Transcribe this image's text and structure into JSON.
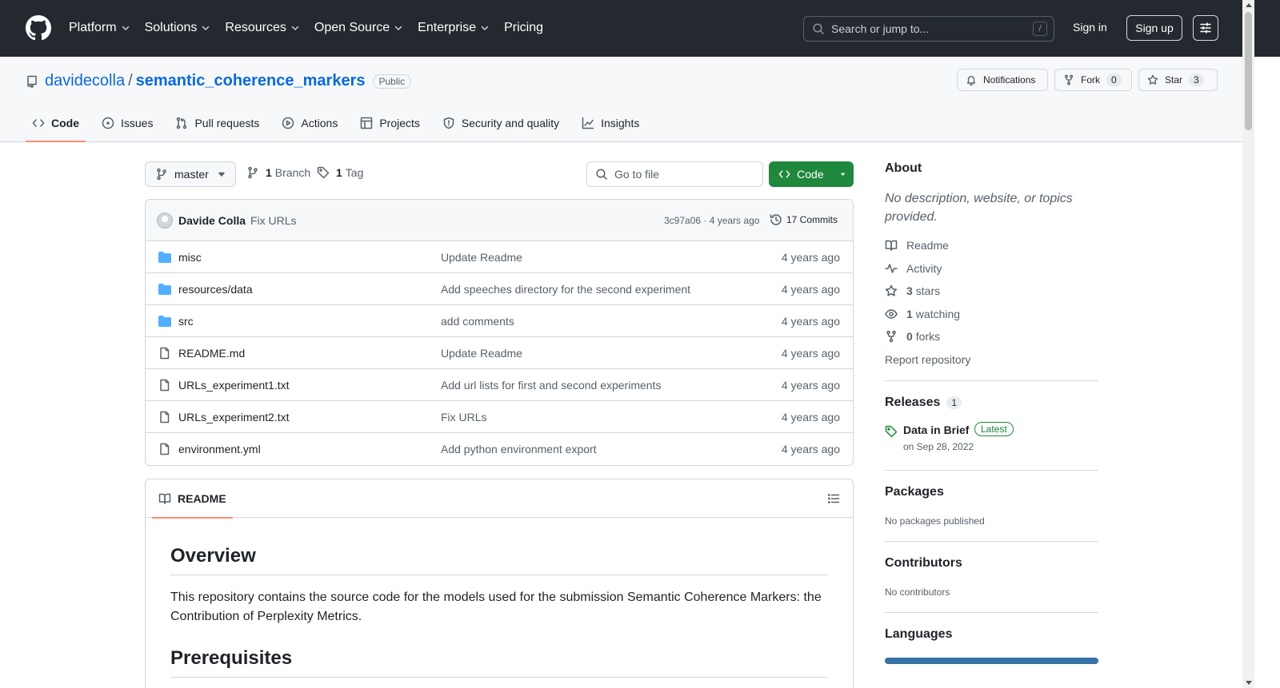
{
  "header": {
    "nav": [
      "Platform",
      "Solutions",
      "Resources",
      "Open Source",
      "Enterprise",
      "Pricing"
    ],
    "search_placeholder": "Search or jump to...",
    "search_shortcut": "/",
    "signin": "Sign in",
    "signup": "Sign up"
  },
  "repo": {
    "owner": "davidecolla",
    "separator": "/",
    "name": "semantic_coherence_markers",
    "visibility": "Public",
    "notifications": "Notifications",
    "fork": "Fork",
    "fork_count": "0",
    "star": "Star",
    "star_count": "3"
  },
  "tabs": [
    "Code",
    "Issues",
    "Pull requests",
    "Actions",
    "Projects",
    "Security and quality",
    "Insights"
  ],
  "toolbar": {
    "branch": "master",
    "branch_count": "1",
    "branch_label": "Branch",
    "tag_count": "1",
    "tag_label": "Tag",
    "go_to_file": "Go to file",
    "code": "Code"
  },
  "commit": {
    "author": "Davide Colla",
    "message": "Fix URLs",
    "hash_age": "3c97a06 · 4 years ago",
    "commits": "17 Commits"
  },
  "files": [
    {
      "type": "folder",
      "name": "misc",
      "message": "Update Readme",
      "age": "4 years ago"
    },
    {
      "type": "folder",
      "name": "resources/data",
      "message": "Add speeches directory for the second experiment",
      "age": "4 years ago"
    },
    {
      "type": "folder",
      "name": "src",
      "message": "add comments",
      "age": "4 years ago"
    },
    {
      "type": "file",
      "name": "README.md",
      "message": "Update Readme",
      "age": "4 years ago"
    },
    {
      "type": "file",
      "name": "URLs_experiment1.txt",
      "message": "Add url lists for first and second experiments",
      "age": "4 years ago"
    },
    {
      "type": "file",
      "name": "URLs_experiment2.txt",
      "message": "Fix URLs",
      "age": "4 years ago"
    },
    {
      "type": "file",
      "name": "environment.yml",
      "message": "Add python environment export",
      "age": "4 years ago"
    }
  ],
  "readme": {
    "tab": "README",
    "h_overview": "Overview",
    "p_overview": "This repository contains the source code for the models used for the submission Semantic Coherence Markers: the Contribution of Perplexity Metrics.",
    "h_prereq": "Prerequisites"
  },
  "sidebar": {
    "about_title": "About",
    "about_desc": "No description, website, or topics provided.",
    "readme": "Readme",
    "activity": "Activity",
    "stars_count": "3",
    "stars_label": "stars",
    "watching_count": "1",
    "watching_label": "watching",
    "forks_count": "0",
    "forks_label": "forks",
    "report": "Report repository",
    "releases_title": "Releases",
    "releases_count": "1",
    "release_name": "Data in Brief",
    "release_badge": "Latest",
    "release_date": "on Sep 28, 2022",
    "packages_title": "Packages",
    "packages_desc": "No packages published",
    "contributors_title": "Contributors",
    "contributors_desc": "No contributors",
    "languages_title": "Languages"
  },
  "colors": {
    "header_bg": "#24292f",
    "link": "#0969da",
    "primary_button": "#1f883d",
    "active_tab_underline": "#fd8c73",
    "folder_icon": "#54aeff",
    "language_bar": "#3572a5"
  }
}
